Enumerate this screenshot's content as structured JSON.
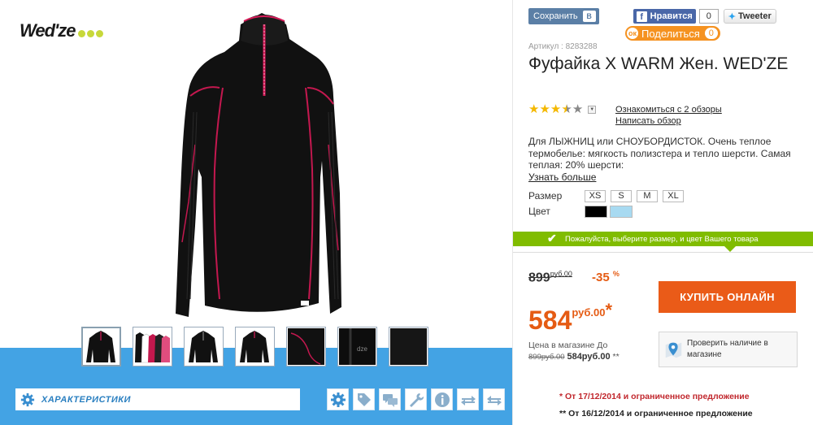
{
  "brand": {
    "logo_text": "Wed'ze"
  },
  "gallery": {
    "thumbnails": [
      {
        "alt": "front"
      },
      {
        "alt": "colors"
      },
      {
        "alt": "front-2"
      },
      {
        "alt": "back"
      },
      {
        "alt": "detail-sleeve"
      },
      {
        "alt": "detail-logo"
      },
      {
        "alt": "detail-fabric"
      }
    ],
    "tabs": {
      "characteristics_label": "ХАРАКТЕРИСТИКИ"
    },
    "tool_icons": [
      "gear-icon",
      "tag-icon",
      "comments-icon",
      "wrench-icon",
      "info-icon",
      "swap-icon",
      "swap-alt-icon"
    ]
  },
  "social": {
    "vk_label": "Сохранить",
    "vk_logo": "В",
    "fb_label": "Нравится",
    "fb_count": "0",
    "tw_label": "Tweeter",
    "ok_label": "Поделиться",
    "ok_count": "0"
  },
  "product": {
    "article": "Артикул : 8283288",
    "title": "Фуфайка X WARM Жен. WED'ZE",
    "rating": 3.5,
    "rating_max": 5,
    "reviews_link": "Ознакомиться с 2 обзоры",
    "write_review_link": "Написать обзор",
    "description": "Для ЛЫЖНИЦ или СНОУБОРДИСТОК. Очень теплое термобелье: мягкость полизстера и тепло шерсти. Самая теплая: 20% шерсти:",
    "more_link": "Узнать больше",
    "size_label": "Размер",
    "sizes": [
      "XS",
      "S",
      "M",
      "XL"
    ],
    "color_label": "Цвет",
    "colors": [
      "#000000",
      "#a8daf1"
    ],
    "select_prompt": "Пожалуйста, выберите размер, и цвет Вашего товара"
  },
  "pricing": {
    "old_price": "899",
    "old_price_unit": "руб.00",
    "discount": "-35",
    "discount_unit": "%",
    "new_price": "584",
    "new_price_unit": "руб.00",
    "new_price_mark": "*",
    "buy_button": "КУПИТЬ ОНЛАЙН",
    "store_line1": "Цена в магазине До",
    "store_old": "899руб.00",
    "store_new": "584руб.00",
    "store_mark": "**",
    "check_store": "Проверить наличие в магазине",
    "promo1": "* От 17/12/2014 и ограниченное предложение",
    "promo2": "** От 16/12/2014 и ограниченное предложение"
  },
  "colors_ui": {
    "accent_orange": "#ea5b18",
    "accent_green": "#80bc00",
    "accent_blue": "#43a3e4",
    "star": "#f4b800"
  }
}
